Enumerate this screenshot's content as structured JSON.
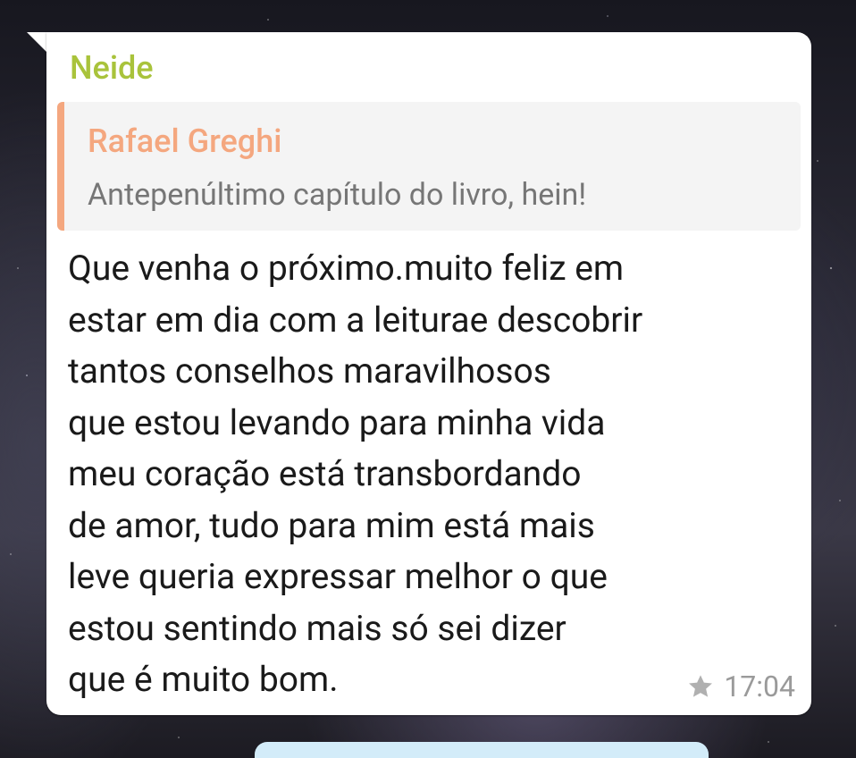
{
  "message": {
    "sender": "Neide",
    "reply": {
      "author": "Rafael Greghi",
      "text": "Antepenúltimo capítulo do livro, hein!"
    },
    "lines": [
      "Que venha o próximo.muito feliz em",
      "estar em dia com a leiturae descobrir",
      "tantos conselhos maravilhosos",
      "que estou levando para minha vida",
      "meu coração está transbordando",
      "de amor, tudo para mim está mais",
      "leve queria expressar melhor o que",
      "estou sentindo mais só sei dizer",
      "que é muito bom."
    ],
    "time": "17:04",
    "starred_icon": "star-icon"
  },
  "colors": {
    "sender": "#a9c33b",
    "reply_accent": "#f4a77f",
    "next_bubble": "#d3ecf9"
  }
}
